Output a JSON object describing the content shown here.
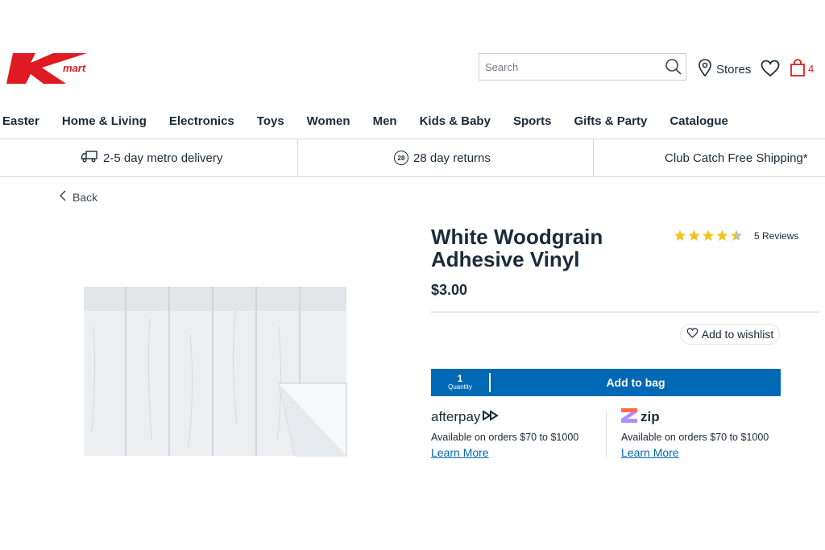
{
  "brand": {
    "logo_text": "Kmart",
    "accent_color": "#e01a22",
    "primary_blue": "#0068b4"
  },
  "header": {
    "search_placeholder": "Search",
    "stores_label": "Stores",
    "bag_count": "4"
  },
  "nav": {
    "items": [
      "Easter",
      "Home & Living",
      "Electronics",
      "Toys",
      "Women",
      "Men",
      "Kids & Baby",
      "Sports",
      "Gifts & Party",
      "Catalogue"
    ]
  },
  "benefits": {
    "delivery": "2-5 day metro delivery",
    "returns_icon_num": "28",
    "returns": "28 day returns",
    "shipping": "Club Catch Free Shipping*"
  },
  "back_label": "Back",
  "product": {
    "title": "White Woodgrain Adhesive Vinyl",
    "price": "$3.00",
    "rating": 4.5,
    "rating_max": 5,
    "reviews_label": "5 Reviews",
    "wishlist_label": "Add to wishlist",
    "quantity_value": "1",
    "quantity_label": "Quantity",
    "add_to_bag_label": "Add to bag"
  },
  "payments": {
    "afterpay": {
      "logo_text": "afterpay",
      "availability": "Available on orders $70 to $1000",
      "link": "Learn More"
    },
    "zip": {
      "logo_text": "zip",
      "availability": "Available on orders $70 to $1000",
      "link": "Learn More"
    }
  }
}
